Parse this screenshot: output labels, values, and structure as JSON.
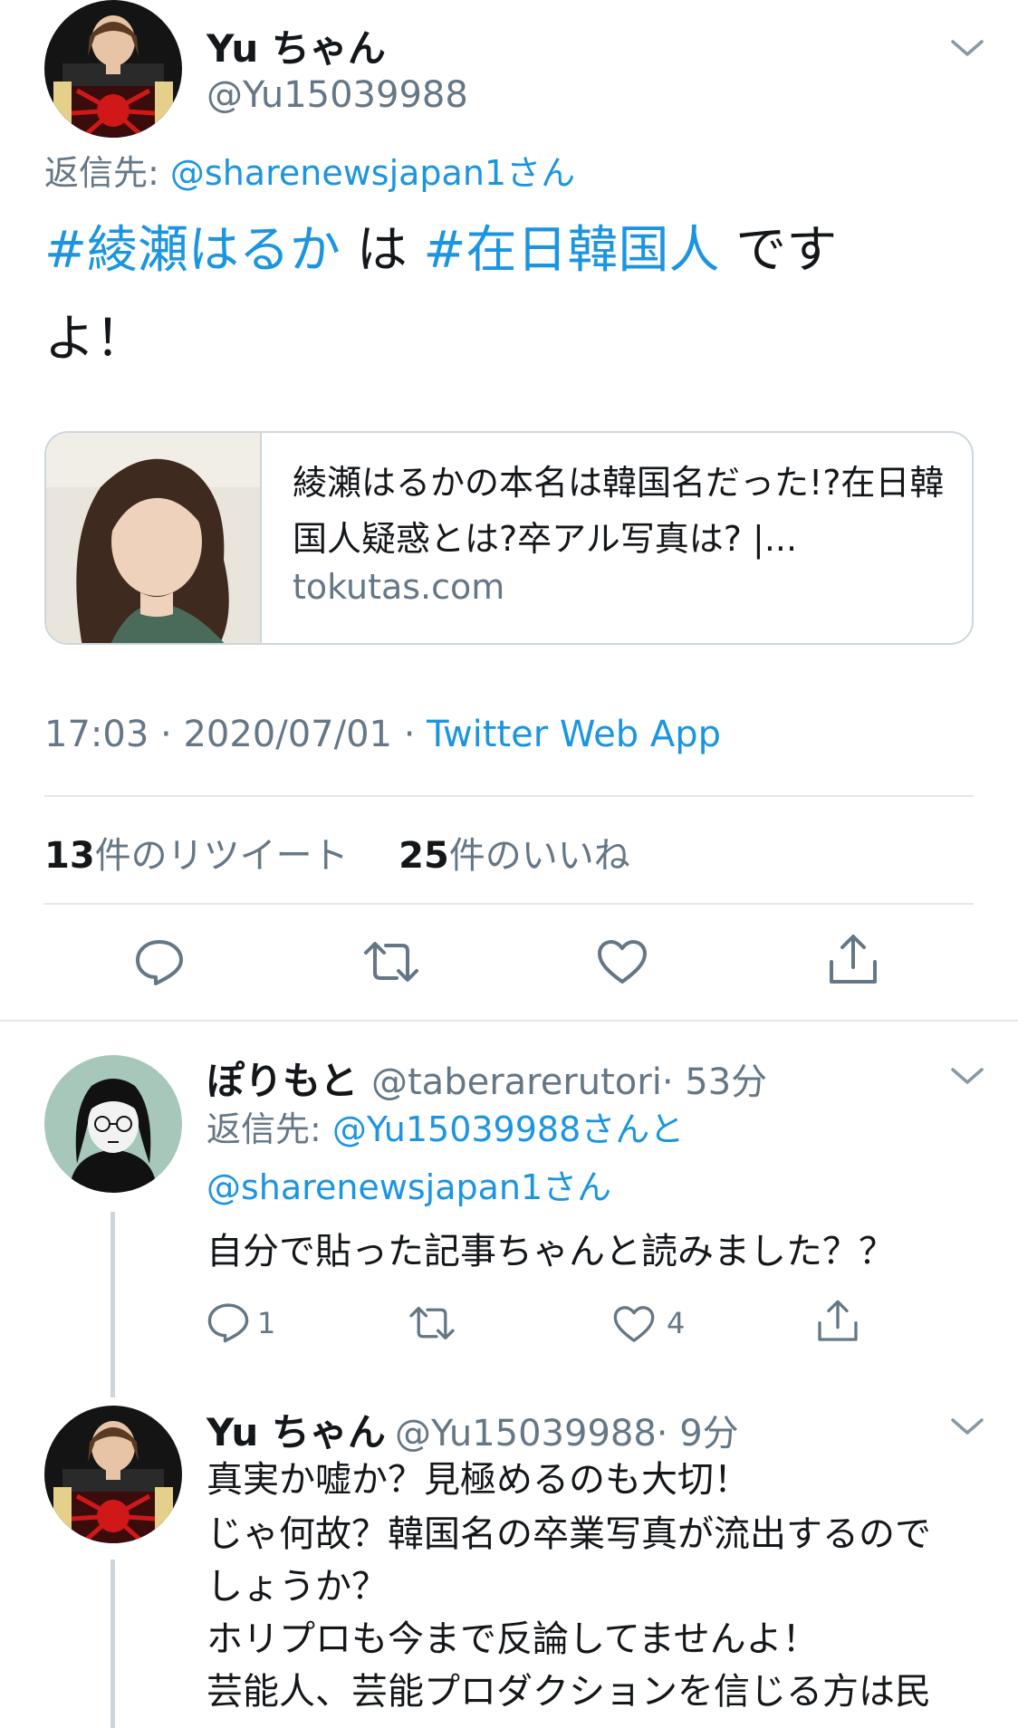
{
  "main_tweet": {
    "author_name": "Yu ちゃん",
    "author_handle": "@Yu15039988",
    "reply_prefix": "返信先:",
    "reply_to": "@sharenewsjapan1さん",
    "text": {
      "hashtag1": "#綾瀬はるか",
      "mid": " は ",
      "hashtag2": "#在日韓国人",
      "tail": " です",
      "line2": "よ！"
    },
    "card": {
      "title": "綾瀬はるかの本名は韓国名だった!?在日韓国人疑惑とは?卒アル写真は? |...",
      "domain": "tokutas.com"
    },
    "time": "17:03",
    "date": "2020/07/01",
    "client": "Twitter Web App",
    "dot": "·",
    "retweet_count": "13",
    "retweet_label": "件のリツイート",
    "like_count": "25",
    "like_label": "件のいいね"
  },
  "reply1": {
    "author_name": "ぽりもと",
    "author_handle": "@taberarerutori",
    "time_ago": "· 53分",
    "reply_prefix": "返信先:",
    "reply_to_1": "@Yu15039988さんと",
    "reply_to_2": "@sharenewsjapan1さん",
    "text": "自分で貼った記事ちゃんと読みました？？",
    "reply_count": "1",
    "like_count": "4"
  },
  "reply2": {
    "author_name": "Yu ちゃん",
    "author_handle": "@Yu15039988",
    "time_ago": "· 9分",
    "lines": [
      "真実か嘘か？見極めるのも大切！",
      "じゃ何故？韓国名の卒業写真が流出するので",
      "しょうか？",
      "ホリプロも今まで反論してませんよ！",
      "芸能人、芸能プロダクションを信じる方は民"
    ]
  },
  "colors": {
    "accent": "#1b95e0",
    "secondary_text": "#657786",
    "divider": "#e1e8ed"
  }
}
